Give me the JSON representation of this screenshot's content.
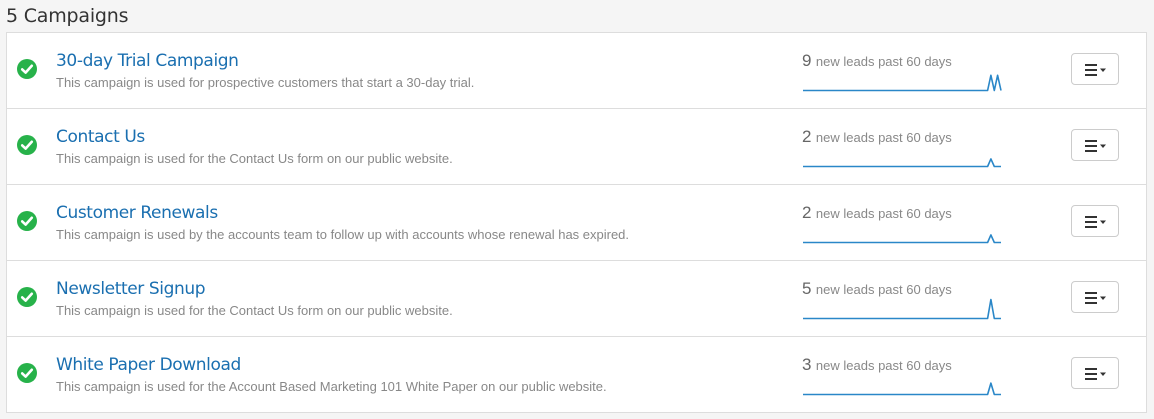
{
  "header": {
    "title": "5 Campaigns"
  },
  "campaigns": [
    {
      "title": "30-day Trial Campaign",
      "description": "This campaign is used for prospective customers that start a 30-day trial.",
      "lead_count": "9",
      "lead_label": "new leads past 60 days",
      "status_icon": "check-circle-icon",
      "sparkline": [
        0,
        0,
        0,
        0,
        0,
        0,
        0,
        0,
        0,
        0,
        0,
        0,
        0,
        0,
        0,
        0,
        0,
        0,
        0,
        0,
        0,
        0,
        0,
        0,
        0,
        0,
        0,
        0,
        0,
        0,
        0,
        0,
        0,
        0,
        0,
        0,
        0,
        0,
        0,
        0,
        0,
        0,
        0,
        0,
        0,
        0,
        0,
        0,
        0,
        0,
        0,
        0,
        0,
        0,
        0,
        0,
        4,
        0,
        4,
        0
      ]
    },
    {
      "title": "Contact Us",
      "description": "This campaign is used for the Contact Us form on our public website.",
      "lead_count": "2",
      "lead_label": "new leads past 60 days",
      "status_icon": "check-circle-icon",
      "sparkline": [
        0,
        0,
        0,
        0,
        0,
        0,
        0,
        0,
        0,
        0,
        0,
        0,
        0,
        0,
        0,
        0,
        0,
        0,
        0,
        0,
        0,
        0,
        0,
        0,
        0,
        0,
        0,
        0,
        0,
        0,
        0,
        0,
        0,
        0,
        0,
        0,
        0,
        0,
        0,
        0,
        0,
        0,
        0,
        0,
        0,
        0,
        0,
        0,
        0,
        0,
        0,
        0,
        0,
        0,
        0,
        0,
        2,
        0,
        0,
        0
      ]
    },
    {
      "title": "Customer Renewals",
      "description": "This campaign is used by the accounts team to follow up with accounts whose renewal has expired.",
      "lead_count": "2",
      "lead_label": "new leads past 60 days",
      "status_icon": "check-circle-icon",
      "sparkline": [
        0,
        0,
        0,
        0,
        0,
        0,
        0,
        0,
        0,
        0,
        0,
        0,
        0,
        0,
        0,
        0,
        0,
        0,
        0,
        0,
        0,
        0,
        0,
        0,
        0,
        0,
        0,
        0,
        0,
        0,
        0,
        0,
        0,
        0,
        0,
        0,
        0,
        0,
        0,
        0,
        0,
        0,
        0,
        0,
        0,
        0,
        0,
        0,
        0,
        0,
        0,
        0,
        0,
        0,
        0,
        0,
        2,
        0,
        0,
        0
      ]
    },
    {
      "title": "Newsletter Signup",
      "description": "This campaign is used for the Contact Us form on our public website.",
      "lead_count": "5",
      "lead_label": "new leads past 60 days",
      "status_icon": "check-circle-icon",
      "sparkline": [
        0,
        0,
        0,
        0,
        0,
        0,
        0,
        0,
        0,
        0,
        0,
        0,
        0,
        0,
        0,
        0,
        0,
        0,
        0,
        0,
        0,
        0,
        0,
        0,
        0,
        0,
        0,
        0,
        0,
        0,
        0,
        0,
        0,
        0,
        0,
        0,
        0,
        0,
        0,
        0,
        0,
        0,
        0,
        0,
        0,
        0,
        0,
        0,
        0,
        0,
        0,
        0,
        0,
        0,
        0,
        0,
        5,
        0,
        0,
        0
      ]
    },
    {
      "title": "White Paper Download",
      "description": "This campaign is used for the Account Based Marketing 101 White Paper on our public website.",
      "lead_count": "3",
      "lead_label": "new leads past 60 days",
      "status_icon": "check-circle-icon",
      "sparkline": [
        0,
        0,
        0,
        0,
        0,
        0,
        0,
        0,
        0,
        0,
        0,
        0,
        0,
        0,
        0,
        0,
        0,
        0,
        0,
        0,
        0,
        0,
        0,
        0,
        0,
        0,
        0,
        0,
        0,
        0,
        0,
        0,
        0,
        0,
        0,
        0,
        0,
        0,
        0,
        0,
        0,
        0,
        0,
        0,
        0,
        0,
        0,
        0,
        0,
        0,
        0,
        0,
        0,
        0,
        0,
        0,
        3,
        0,
        0,
        0
      ]
    }
  ],
  "menu_button_icon": "hamburger-dropdown-icon",
  "colors": {
    "accent": "#1a6fb0",
    "status_green": "#27b24a",
    "sparkline": "#2a87c8"
  }
}
